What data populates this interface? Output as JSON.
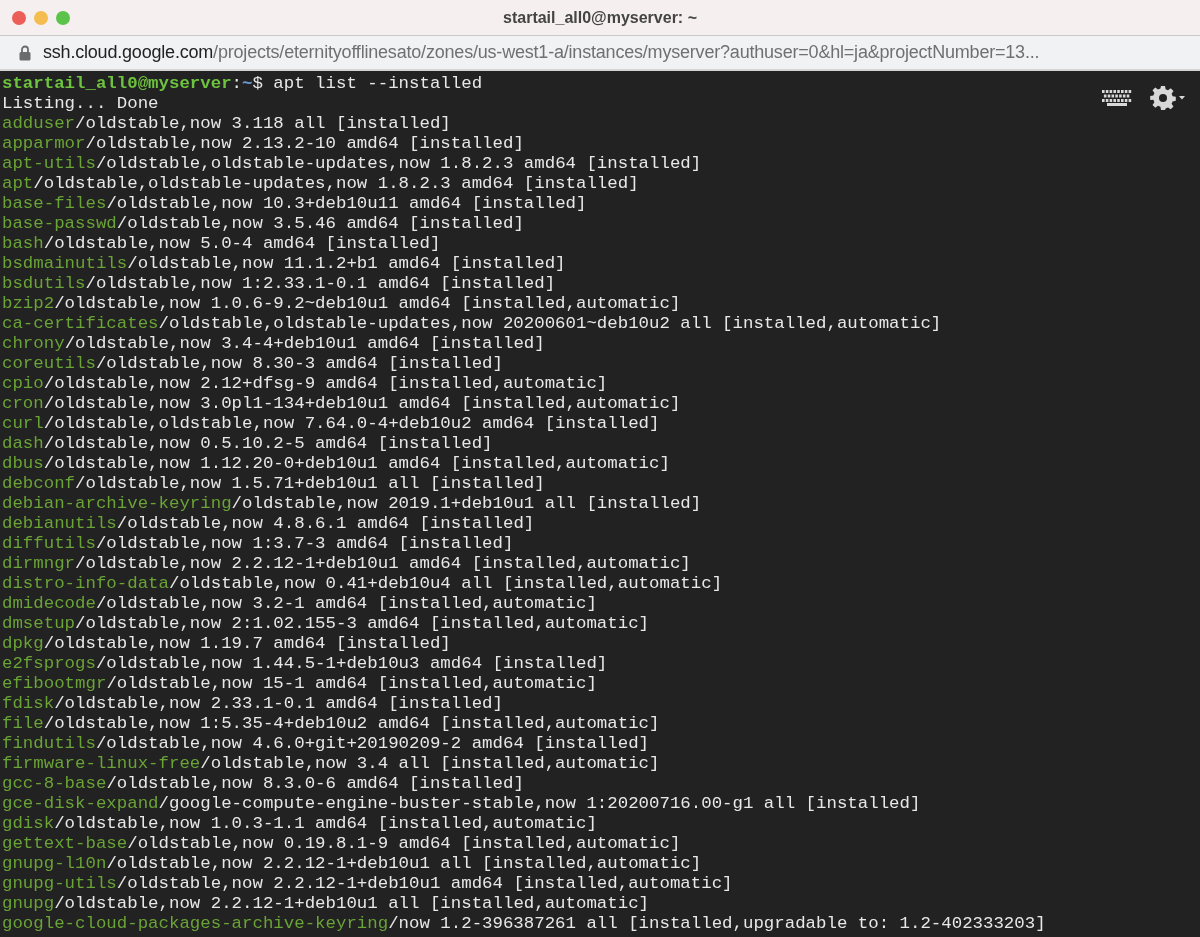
{
  "window": {
    "title": "startail_all0@myserver: ~"
  },
  "address_bar": {
    "host": "ssh.cloud.google.com",
    "path": "/projects/eternityofflinesato/zones/us-west1-a/instances/myserver?authuser=0&hl=ja&projectNumber=13..."
  },
  "terminal": {
    "prompt": {
      "user_host": "startail_all0@myserver",
      "separator": ":",
      "cwd": "~",
      "symbol": "$",
      "command": " apt list --installed"
    },
    "output": "Listing... Done",
    "packages": [
      {
        "name": "adduser",
        "details": "/oldstable,now 3.118 all [installed]"
      },
      {
        "name": "apparmor",
        "details": "/oldstable,now 2.13.2-10 amd64 [installed]"
      },
      {
        "name": "apt-utils",
        "details": "/oldstable,oldstable-updates,now 1.8.2.3 amd64 [installed]"
      },
      {
        "name": "apt",
        "details": "/oldstable,oldstable-updates,now 1.8.2.3 amd64 [installed]"
      },
      {
        "name": "base-files",
        "details": "/oldstable,now 10.3+deb10u11 amd64 [installed]"
      },
      {
        "name": "base-passwd",
        "details": "/oldstable,now 3.5.46 amd64 [installed]"
      },
      {
        "name": "bash",
        "details": "/oldstable,now 5.0-4 amd64 [installed]"
      },
      {
        "name": "bsdmainutils",
        "details": "/oldstable,now 11.1.2+b1 amd64 [installed]"
      },
      {
        "name": "bsdutils",
        "details": "/oldstable,now 1:2.33.1-0.1 amd64 [installed]"
      },
      {
        "name": "bzip2",
        "details": "/oldstable,now 1.0.6-9.2~deb10u1 amd64 [installed,automatic]"
      },
      {
        "name": "ca-certificates",
        "details": "/oldstable,oldstable-updates,now 20200601~deb10u2 all [installed,automatic]"
      },
      {
        "name": "chrony",
        "details": "/oldstable,now 3.4-4+deb10u1 amd64 [installed]"
      },
      {
        "name": "coreutils",
        "details": "/oldstable,now 8.30-3 amd64 [installed]"
      },
      {
        "name": "cpio",
        "details": "/oldstable,now 2.12+dfsg-9 amd64 [installed,automatic]"
      },
      {
        "name": "cron",
        "details": "/oldstable,now 3.0pl1-134+deb10u1 amd64 [installed,automatic]"
      },
      {
        "name": "curl",
        "details": "/oldstable,oldstable,now 7.64.0-4+deb10u2 amd64 [installed]"
      },
      {
        "name": "dash",
        "details": "/oldstable,now 0.5.10.2-5 amd64 [installed]"
      },
      {
        "name": "dbus",
        "details": "/oldstable,now 1.12.20-0+deb10u1 amd64 [installed,automatic]"
      },
      {
        "name": "debconf",
        "details": "/oldstable,now 1.5.71+deb10u1 all [installed]"
      },
      {
        "name": "debian-archive-keyring",
        "details": "/oldstable,now 2019.1+deb10u1 all [installed]"
      },
      {
        "name": "debianutils",
        "details": "/oldstable,now 4.8.6.1 amd64 [installed]"
      },
      {
        "name": "diffutils",
        "details": "/oldstable,now 1:3.7-3 amd64 [installed]"
      },
      {
        "name": "dirmngr",
        "details": "/oldstable,now 2.2.12-1+deb10u1 amd64 [installed,automatic]"
      },
      {
        "name": "distro-info-data",
        "details": "/oldstable,now 0.41+deb10u4 all [installed,automatic]"
      },
      {
        "name": "dmidecode",
        "details": "/oldstable,now 3.2-1 amd64 [installed,automatic]"
      },
      {
        "name": "dmsetup",
        "details": "/oldstable,now 2:1.02.155-3 amd64 [installed,automatic]"
      },
      {
        "name": "dpkg",
        "details": "/oldstable,now 1.19.7 amd64 [installed]"
      },
      {
        "name": "e2fsprogs",
        "details": "/oldstable,now 1.44.5-1+deb10u3 amd64 [installed]"
      },
      {
        "name": "efibootmgr",
        "details": "/oldstable,now 15-1 amd64 [installed,automatic]"
      },
      {
        "name": "fdisk",
        "details": "/oldstable,now 2.33.1-0.1 amd64 [installed]"
      },
      {
        "name": "file",
        "details": "/oldstable,now 1:5.35-4+deb10u2 amd64 [installed,automatic]"
      },
      {
        "name": "findutils",
        "details": "/oldstable,now 4.6.0+git+20190209-2 amd64 [installed]"
      },
      {
        "name": "firmware-linux-free",
        "details": "/oldstable,now 3.4 all [installed,automatic]"
      },
      {
        "name": "gcc-8-base",
        "details": "/oldstable,now 8.3.0-6 amd64 [installed]"
      },
      {
        "name": "gce-disk-expand",
        "details": "/google-compute-engine-buster-stable,now 1:20200716.00-g1 all [installed]"
      },
      {
        "name": "gdisk",
        "details": "/oldstable,now 1.0.3-1.1 amd64 [installed,automatic]"
      },
      {
        "name": "gettext-base",
        "details": "/oldstable,now 0.19.8.1-9 amd64 [installed,automatic]"
      },
      {
        "name": "gnupg-l10n",
        "details": "/oldstable,now 2.2.12-1+deb10u1 all [installed,automatic]"
      },
      {
        "name": "gnupg-utils",
        "details": "/oldstable,now 2.2.12-1+deb10u1 amd64 [installed,automatic]"
      },
      {
        "name": "gnupg",
        "details": "/oldstable,now 2.2.12-1+deb10u1 all [installed,automatic]"
      },
      {
        "name": "google-cloud-packages-archive-keyring",
        "details": "/now 1.2-396387261 all [installed,upgradable to: 1.2-402333203]"
      }
    ]
  }
}
